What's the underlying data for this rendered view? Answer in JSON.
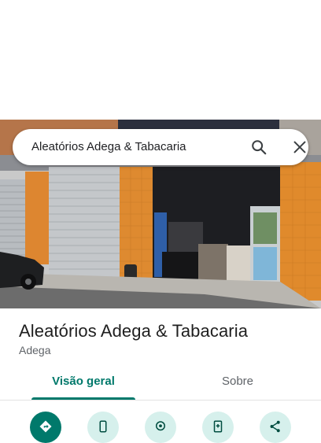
{
  "search": {
    "query": "Aleatórios Adega & Tabacaria"
  },
  "place": {
    "name": "Aleatórios Adega & Tabacaria",
    "category": "Adega"
  },
  "tabs": [
    {
      "label": "Visão geral",
      "active": true
    },
    {
      "label": "Sobre",
      "active": false
    }
  ],
  "actions": [
    {
      "icon": "directions-icon",
      "primary": true
    },
    {
      "icon": "phone-icon",
      "primary": false
    },
    {
      "icon": "location-pin-icon",
      "primary": false
    },
    {
      "icon": "save-bookmark-icon",
      "primary": false
    },
    {
      "icon": "share-icon",
      "primary": false
    }
  ],
  "colors": {
    "accent": "#00796b",
    "action_bg": "#d6f0ec",
    "tile_orange": "#e2892c"
  }
}
